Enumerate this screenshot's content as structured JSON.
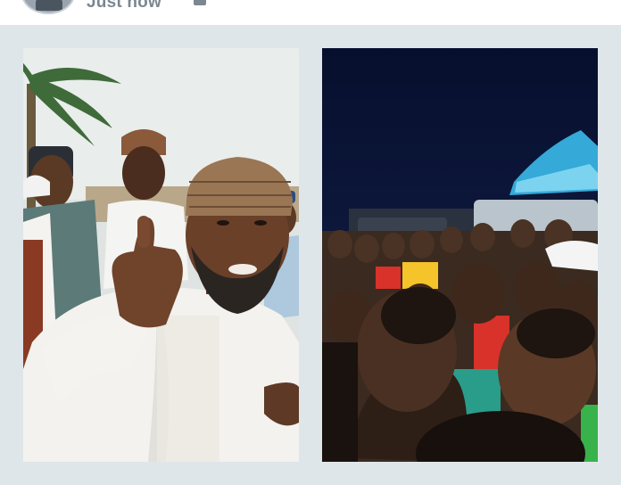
{
  "post": {
    "timestamp": "Just now",
    "audience_icon": "audience-icon"
  },
  "photos": [
    {
      "subject": "man-in-white-kaftan-thumbs-up",
      "icon": "photo"
    },
    {
      "subject": "night-crowd",
      "icon": "photo"
    }
  ],
  "colors": {
    "header_bg": "#ffffff",
    "post_bg": "#dfe6e9",
    "muted_text": "#7b8791"
  }
}
